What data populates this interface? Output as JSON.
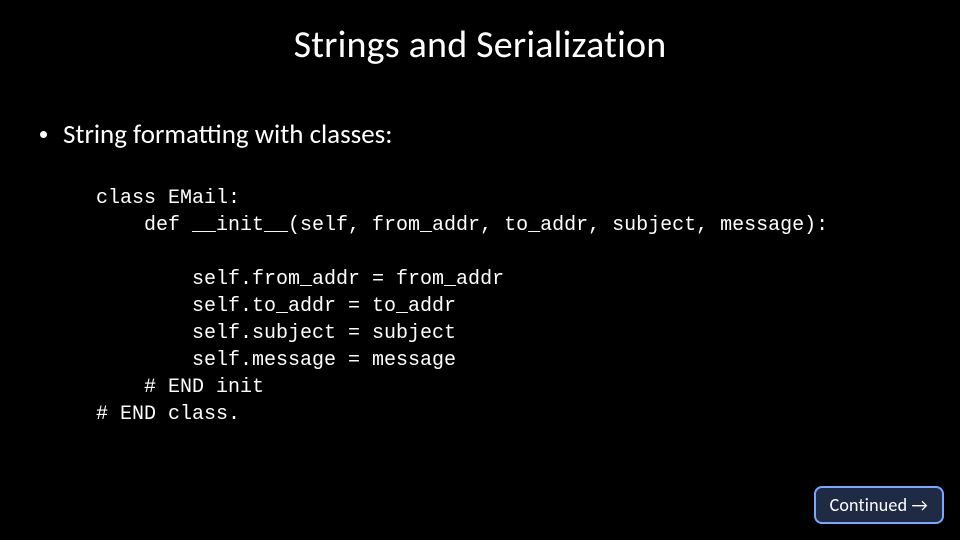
{
  "slide": {
    "title": "Strings and Serialization",
    "bullet": "String formatting with classes:",
    "code": "class EMail:\n    def __init__(self, from_addr, to_addr, subject, message):\n\n        self.from_addr = from_addr\n        self.to_addr = to_addr\n        self.subject = subject\n        self.message = message\n    # END init\n# END class.",
    "continued_label": "Continued →"
  }
}
